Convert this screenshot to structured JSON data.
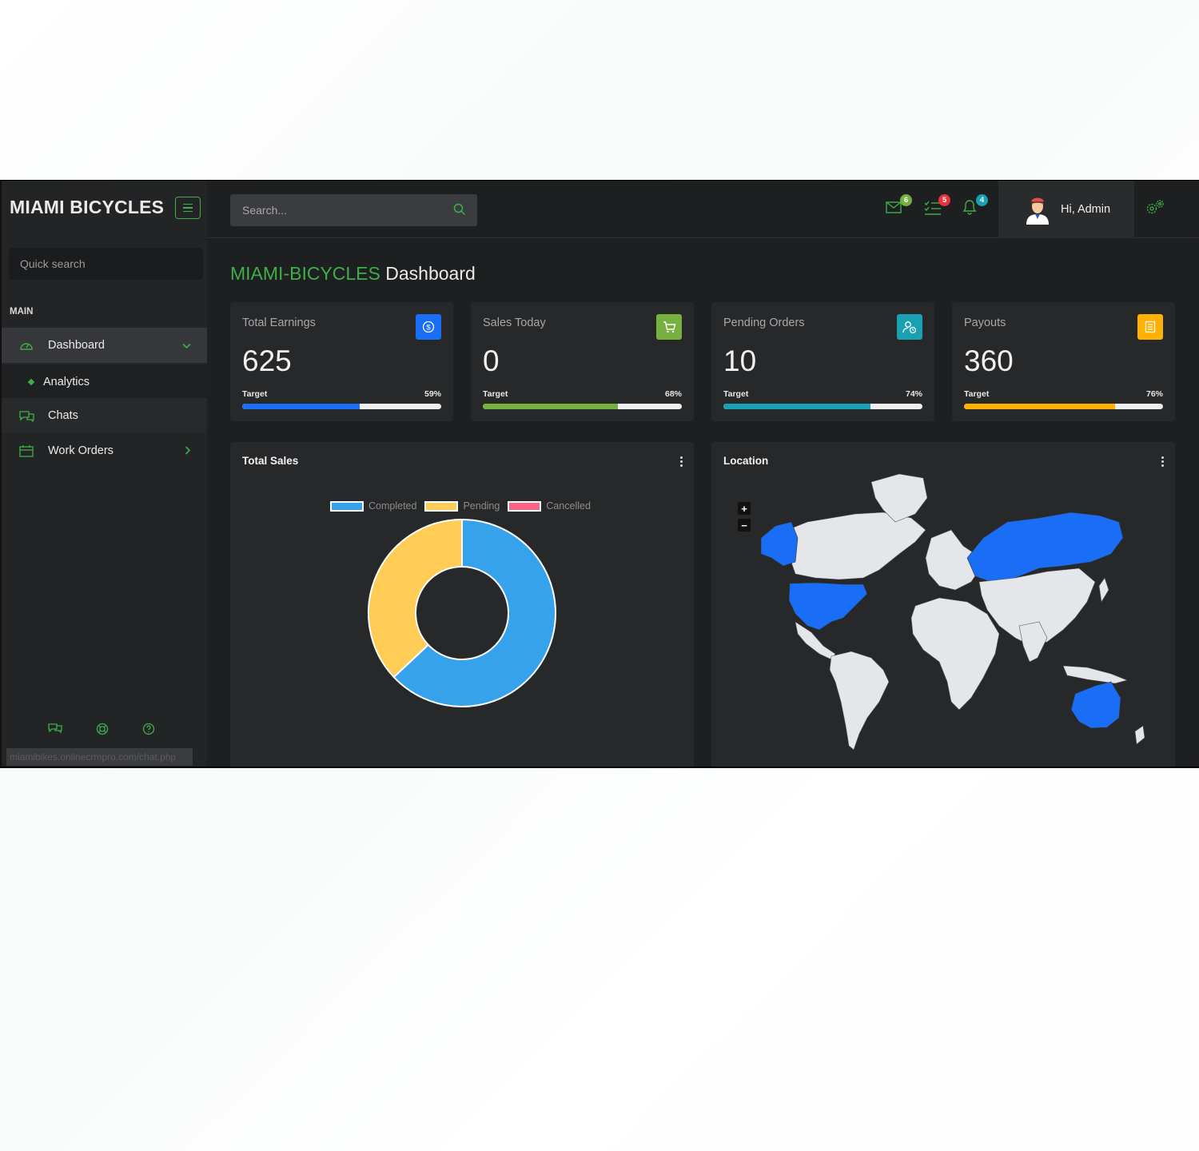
{
  "brand": "MIAMI BICYCLES",
  "sidebar": {
    "quick_search_placeholder": "Quick search",
    "section_label": "MAIN",
    "items": [
      {
        "label": "Dashboard",
        "icon": "speedometer-icon"
      },
      {
        "label": "Analytics",
        "icon": "diamond-bullet"
      },
      {
        "label": "Chats",
        "icon": "chat-icon"
      },
      {
        "label": "Work Orders",
        "icon": "calendar-icon"
      }
    ],
    "footer_icons": [
      "chat-icon",
      "lifebuoy-icon",
      "help-icon"
    ],
    "status_url": "miamibikes.onlinecrmpro.com/chat.php"
  },
  "header": {
    "search_placeholder": "Search...",
    "badges": {
      "mail": "6",
      "tasks": "5",
      "notifications": "4"
    },
    "user_greeting": "Hi, Admin"
  },
  "page_title": {
    "accent": "MIAMI-BICYCLES",
    "rest": " Dashboard"
  },
  "stats": [
    {
      "label": "Total Earnings",
      "value": "625",
      "target_label": "Target",
      "percent": "59%",
      "color": "#1a6df5",
      "icon": "dollar-icon"
    },
    {
      "label": "Sales Today",
      "value": "0",
      "target_label": "Target",
      "percent": "68%",
      "color": "#76b03f",
      "icon": "cart-icon"
    },
    {
      "label": "Pending Orders",
      "value": "10",
      "target_label": "Target",
      "percent": "74%",
      "color": "#19a1b1",
      "icon": "user-clock-icon"
    },
    {
      "label": "Payouts",
      "value": "360",
      "target_label": "Target",
      "percent": "76%",
      "color": "#ffb100",
      "icon": "receipt-icon"
    }
  ],
  "total_sales": {
    "title": "Total Sales"
  },
  "location": {
    "title": "Location",
    "zoom_in": "+",
    "zoom_out": "−"
  },
  "chart_data": {
    "type": "pie",
    "title": "Total Sales",
    "categories": [
      "Completed",
      "Pending",
      "Cancelled"
    ],
    "values": [
      63,
      37,
      0
    ],
    "colors": [
      "#36a2eb",
      "#ffcd56",
      "#ff6384"
    ],
    "donut": true,
    "legend": "top"
  }
}
